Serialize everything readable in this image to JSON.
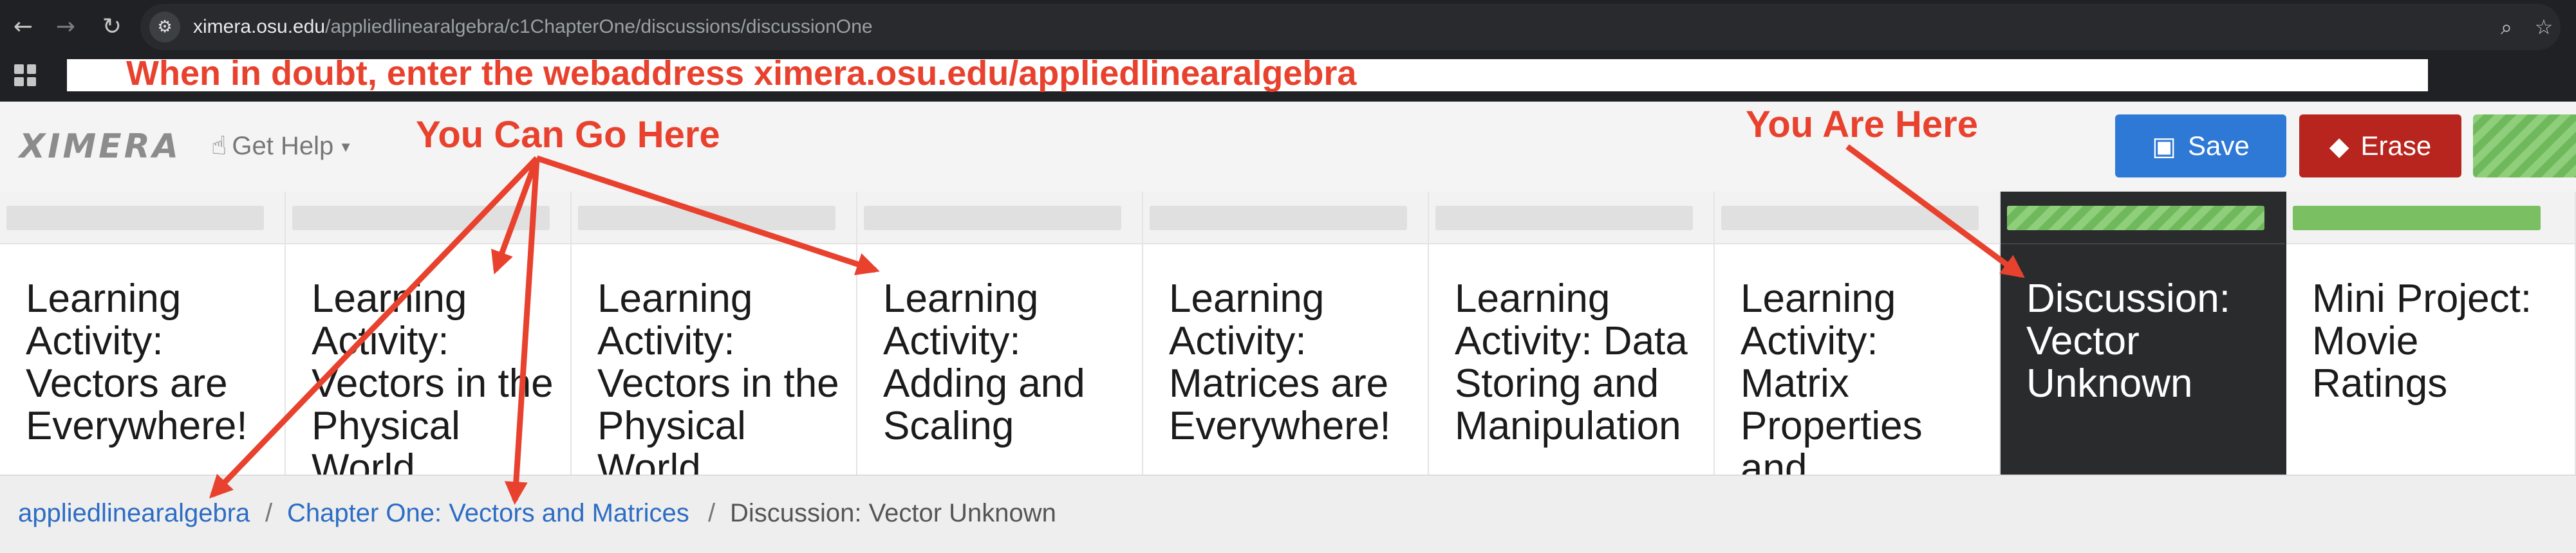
{
  "browser": {
    "url_host": "ximera.osu.edu",
    "url_path": "/appliedlinearalgebra/c1ChapterOne/discussions/discussionOne",
    "icons": [
      "back-icon",
      "forward-icon",
      "reload-icon",
      "site-info-icon",
      "zoom-icon",
      "star-icon",
      "apps-icon"
    ]
  },
  "annotations": {
    "top_banner": "When in doubt, enter the webaddress ximera.osu.edu/appliedlinearalgebra",
    "you_can_go_here": "You Can Go Here",
    "you_are_here": "You Are Here",
    "color": "#e8422e"
  },
  "header": {
    "logo": "XIMERA",
    "help_label": "Get Help",
    "save_label": "Save",
    "erase_label": "Erase"
  },
  "activities": [
    {
      "title": "Learning Activity: Vectors are Everywhere!",
      "status": "not-started"
    },
    {
      "title": "Learning Activity: Vectors in the Physical World",
      "status": "not-started"
    },
    {
      "title": "Learning Activity: Vectors in the Physical World",
      "status": "not-started"
    },
    {
      "title": "Learning Activity: Adding and Scaling",
      "status": "not-started"
    },
    {
      "title": "Learning Activity: Matrices are Everywhere!",
      "status": "not-started"
    },
    {
      "title": "Learning Activity: Data Storing and Manipulation",
      "status": "not-started"
    },
    {
      "title": "Learning Activity: Matrix Properties and",
      "status": "not-started"
    },
    {
      "title": "Discussion: Vector Unknown",
      "status": "current"
    },
    {
      "title": "Mini Project: Movie Ratings",
      "status": "completed"
    }
  ],
  "breadcrumb": {
    "items": [
      "appliedlinearalgebra",
      "Chapter One: Vectors and Matrices",
      "Discussion: Vector Unknown"
    ],
    "separator": "/"
  },
  "colors": {
    "save": "#2f79d6",
    "erase": "#b8251e",
    "progress_green": "#7bbf63",
    "link": "#2c6cc4"
  }
}
